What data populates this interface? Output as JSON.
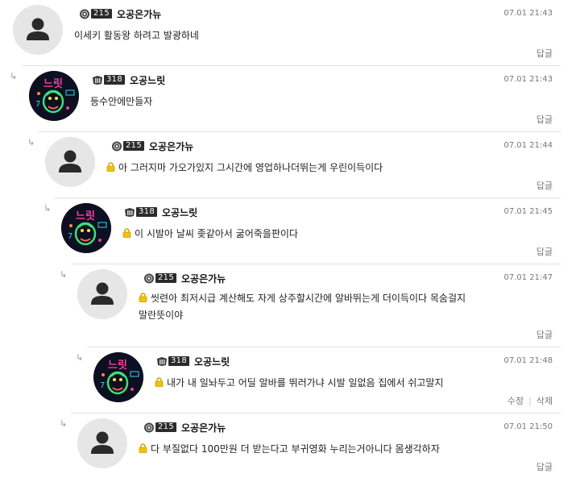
{
  "reply_label": "답글",
  "edit_label": "수정",
  "delete_label": "삭제",
  "comments": [
    {
      "badge_level": "215",
      "nickname": "오공은가뉴",
      "date": "07.01 21:43",
      "text": "이세키 활동왕 하려고 발광하네",
      "locked": false
    },
    {
      "badge_level": "318",
      "nickname": "오공느릿",
      "date": "07.01 21:43",
      "text": "등수안에만들자",
      "locked": false
    },
    {
      "badge_level": "215",
      "nickname": "오공은가뉴",
      "date": "07.01 21:44",
      "text": "아 그러지마 가오가있지 그시간에 영업하나더뛰는게 우린이득이다",
      "locked": true
    },
    {
      "badge_level": "318",
      "nickname": "오공느릿",
      "date": "07.01 21:45",
      "text": "이 시발아 날씨 좆같아서 굶어죽을판이다",
      "locked": true
    },
    {
      "badge_level": "215",
      "nickname": "오공은가뉴",
      "date": "07.01 21:47",
      "text_line1": "씻련아 최저시급 계산해도 자게 상주할시간에 알바뛰는게 더이득이다 목숨걸지",
      "text_line2": "말란뜻이야",
      "locked": true
    },
    {
      "badge_level": "318",
      "nickname": "오공느릿",
      "date": "07.01 21:48",
      "text": "내가 내 일놔두고 어딜 알바를 뛰러가냐 시발 일없음 집에서 쉬고말지",
      "locked": true
    },
    {
      "badge_level": "215",
      "nickname": "오공은가뉴",
      "date": "07.01 21:50",
      "text": "다 부질없다 100만원 더 받는다고 부귀영화 누리는거아니다 몸생각하자",
      "locked": true
    }
  ]
}
